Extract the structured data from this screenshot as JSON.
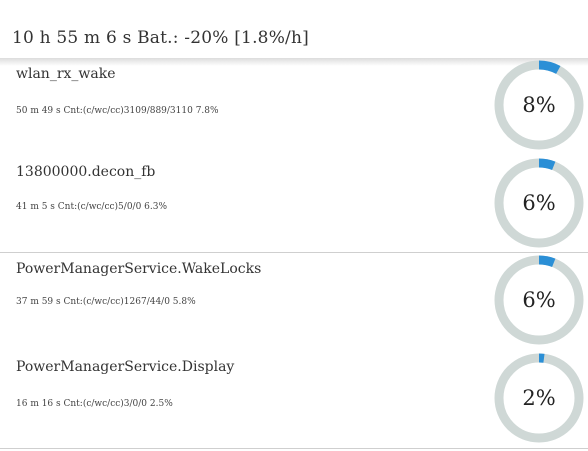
{
  "header": {
    "title": "10 h 55 m 6 s  Bat.: -20% [1.8%/h]"
  },
  "colors": {
    "ring_track": "#cfd8d6",
    "ring_fill": "#2b8fd6"
  },
  "rows": [
    {
      "name": "wlan_rx_wake",
      "stats": "50 m 49 s  Cnt:(c/wc/cc)3109/889/3110  7.8%",
      "percent_label": "8%",
      "percent": 8
    },
    {
      "name": "13800000.decon_fb",
      "stats": "41 m 5 s  Cnt:(c/wc/cc)5/0/0  6.3%",
      "percent_label": "6%",
      "percent": 6
    },
    {
      "name": "PowerManagerService.WakeLocks",
      "stats": "37 m 59 s  Cnt:(c/wc/cc)1267/44/0  5.8%",
      "percent_label": "6%",
      "percent": 6
    },
    {
      "name": "PowerManagerService.Display",
      "stats": "16 m 16 s  Cnt:(c/wc/cc)3/0/0  2.5%",
      "percent_label": "2%",
      "percent": 2
    }
  ]
}
